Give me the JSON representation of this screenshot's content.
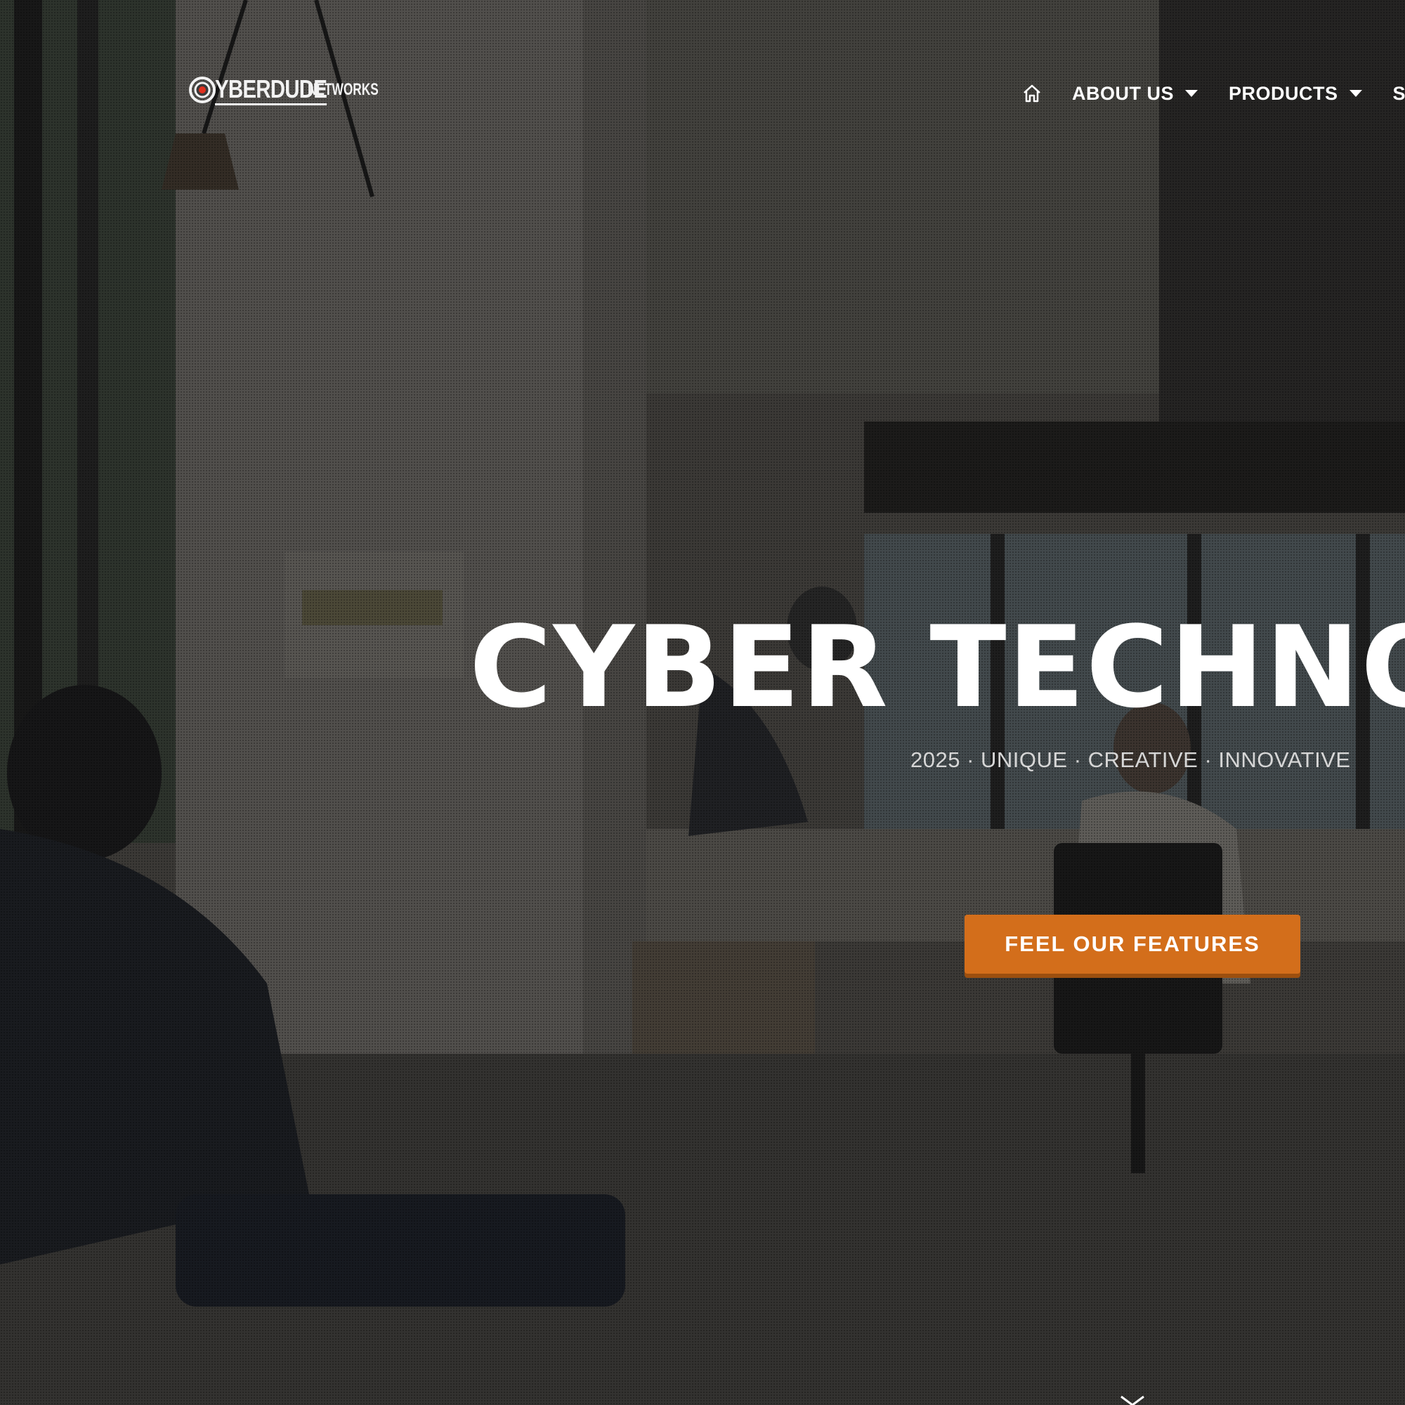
{
  "logo": {
    "word": "YBERDUDE",
    "sub": "NETWORKS"
  },
  "nav": {
    "home_icon": "home-icon",
    "items": [
      {
        "label": "ABOUT US",
        "has_dropdown": true
      },
      {
        "label": "PRODUCTS",
        "has_dropdown": true
      },
      {
        "label": "S",
        "has_dropdown": false
      }
    ]
  },
  "hero": {
    "headline": "CYBER TECHNO",
    "tagline": "2025 · UNIQUE · CREATIVE · INNOVATIVE",
    "cta_label": "FEEL OUR FEATURES",
    "scroll_icon": "chevron-down-icon"
  },
  "colors": {
    "accent": "#d36e1b",
    "text": "#ffffff",
    "overlay": "#141414"
  }
}
